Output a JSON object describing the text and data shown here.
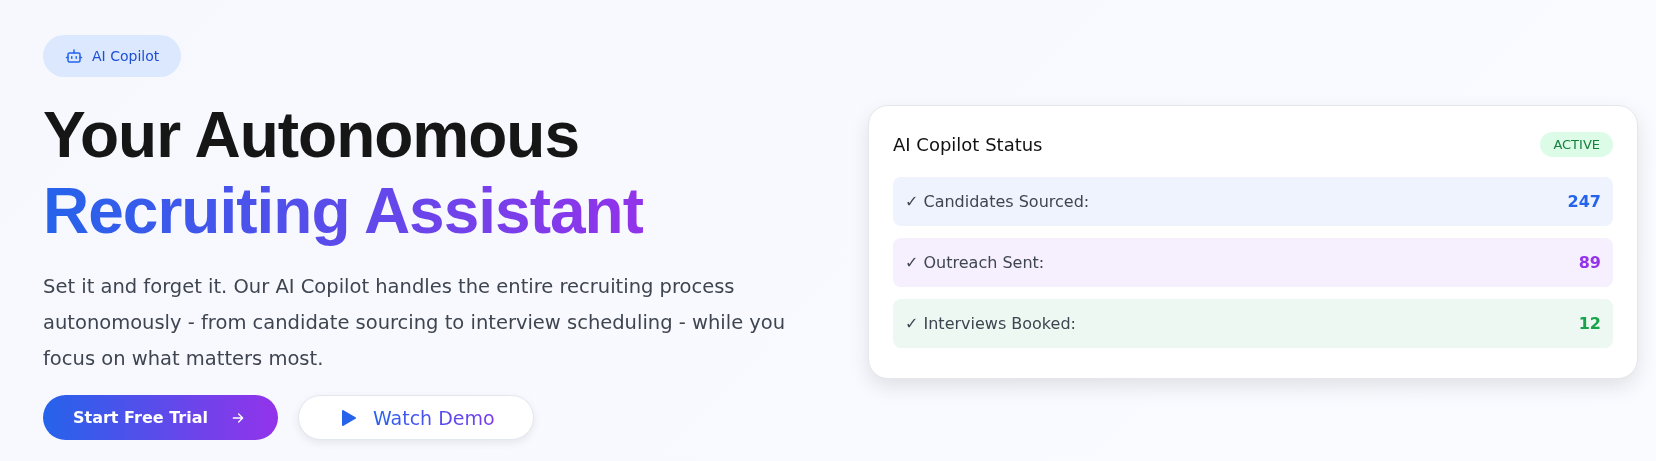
{
  "badge": {
    "label": "AI Copilot"
  },
  "headline": {
    "line_1": "Your Autonomous",
    "line_2": "Recruiting Assistant"
  },
  "description": "Set it and forget it. Our AI Copilot handles the entire recruiting process autonomously - from candidate sourcing to interview scheduling - while you focus on what matters most.",
  "buttons": [
    {
      "kind": "primary",
      "label": "Start Free Trial"
    },
    {
      "kind": "secondary",
      "label": "Watch Demo"
    }
  ],
  "status_card": {
    "title": "AI Copilot Status",
    "status": "ACTIVE",
    "rows": [
      {
        "label": "✓ Candidates Sourced:",
        "value": "247",
        "color": "#2563eb"
      },
      {
        "label": "✓ Outreach Sent:",
        "value": "89",
        "color": "#9333ea"
      },
      {
        "label": "✓ Interviews Booked:",
        "value": "12",
        "color": "#16a34a"
      }
    ]
  }
}
